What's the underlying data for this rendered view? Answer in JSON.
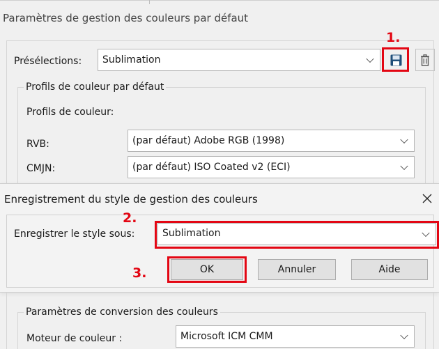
{
  "window": {
    "title": "Paramètres de gestion des couleurs par défaut"
  },
  "presets": {
    "label": "Présélections:",
    "value": "Sublimation",
    "save_icon": "floppy-disk-icon",
    "delete_icon": "trash-icon"
  },
  "profiles": {
    "legend": "Profils de couleur par défaut",
    "sublabel": "Profils de couleur:",
    "rgb_label": "RVB:",
    "rgb_value": "(par défaut) Adobe RGB (1998)",
    "cmyk_label": "CMJN:",
    "cmyk_value": "(par défaut) ISO Coated v2 (ECI)"
  },
  "dialog": {
    "title": "Enregistrement du style de gestion des couleurs",
    "close_icon": "close-icon",
    "save_as_label": "Enregistrer le style sous:",
    "save_as_value": "Sublimation",
    "ok_label": "OK",
    "cancel_label": "Annuler",
    "help_label": "Aide"
  },
  "conversion": {
    "legend": "Paramètres de conversion des couleurs",
    "engine_label": "Moteur de couleur :",
    "engine_value": "Microsoft ICM CMM"
  },
  "annotations": {
    "step1": "1.",
    "step2": "2.",
    "step3": "3.",
    "highlight_color": "#e30613"
  }
}
